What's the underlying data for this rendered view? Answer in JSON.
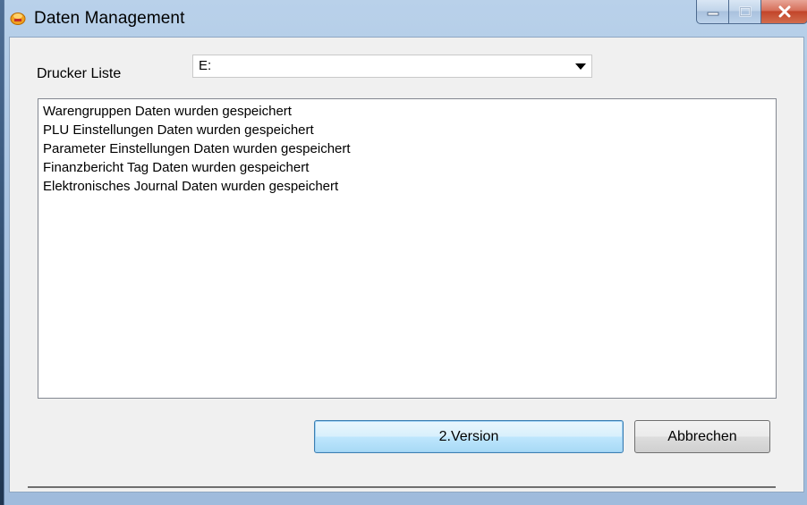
{
  "window": {
    "title": "Daten Management",
    "icon": "app-icon",
    "caption_buttons": [
      "minimize-icon",
      "maximize-icon",
      "close-icon"
    ]
  },
  "form": {
    "printer_label": "Drucker Liste",
    "printer_value": "E:",
    "log_lines": [
      "Warengruppen Daten wurden gespeichert",
      "PLU Einstellungen Daten wurden gespeichert",
      "Parameter Einstellungen Daten wurden gespeichert",
      "Finanzbericht Tag Daten wurden gespeichert",
      "Elektronisches Journal Daten wurden gespeichert"
    ]
  },
  "buttons": {
    "version_label": "2.Version",
    "cancel_label": "Abbrechen"
  },
  "colors": {
    "title_bar": "#b9d1ea",
    "close_button": "#c2452a",
    "focus_border": "#3c7fb1"
  }
}
